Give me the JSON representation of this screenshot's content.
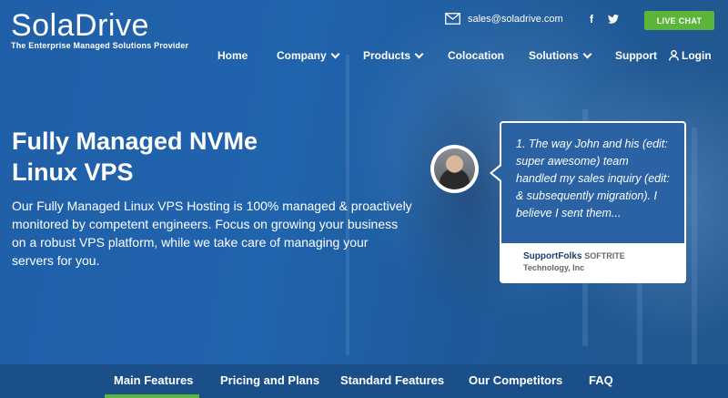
{
  "header": {
    "logo_text": "SolaDrive",
    "tagline": "The Enterprise Managed Solutions Provider",
    "email": "sales@soladrive.com",
    "facebook_glyph": "f",
    "live_chat": "LIVE CHAT"
  },
  "nav": {
    "items": [
      {
        "label": "Home"
      },
      {
        "label": "Company"
      },
      {
        "label": "Products"
      },
      {
        "label": "Colocation"
      },
      {
        "label": "Solutions"
      },
      {
        "label": "Support"
      },
      {
        "label": "Login"
      }
    ]
  },
  "hero": {
    "title_line1": "Fully Managed NVMe",
    "title_line2": "Linux VPS",
    "description": "Our Fully Managed Linux VPS Hosting is 100% managed & proactively monitored by competent engineers. Focus on growing your business on a robust VPS platform, while we take care of managing your servers for you."
  },
  "testimonial": {
    "quote": "1. The way John and his (edit: super awesome) team handled my sales inquiry (edit: & subsequently migration). I believe I sent them...",
    "author": "SupportFolks",
    "company_line1": "SOFTRITE",
    "company_line2": "Technology, Inc"
  },
  "tabs": {
    "items": [
      {
        "label": "Main Features"
      },
      {
        "label": "Pricing and Plans"
      },
      {
        "label": "Standard Features"
      },
      {
        "label": "Our Competitors"
      },
      {
        "label": "FAQ"
      }
    ],
    "active": "Main Features"
  },
  "colors": {
    "accent_green": "#5bb53b",
    "hero_blue": "#1f5fa8",
    "tabbar_blue": "#1a4f8a"
  },
  "icons": [
    "envelope-icon",
    "facebook-icon",
    "twitter-icon",
    "chevron-down-icon",
    "user-icon"
  ]
}
